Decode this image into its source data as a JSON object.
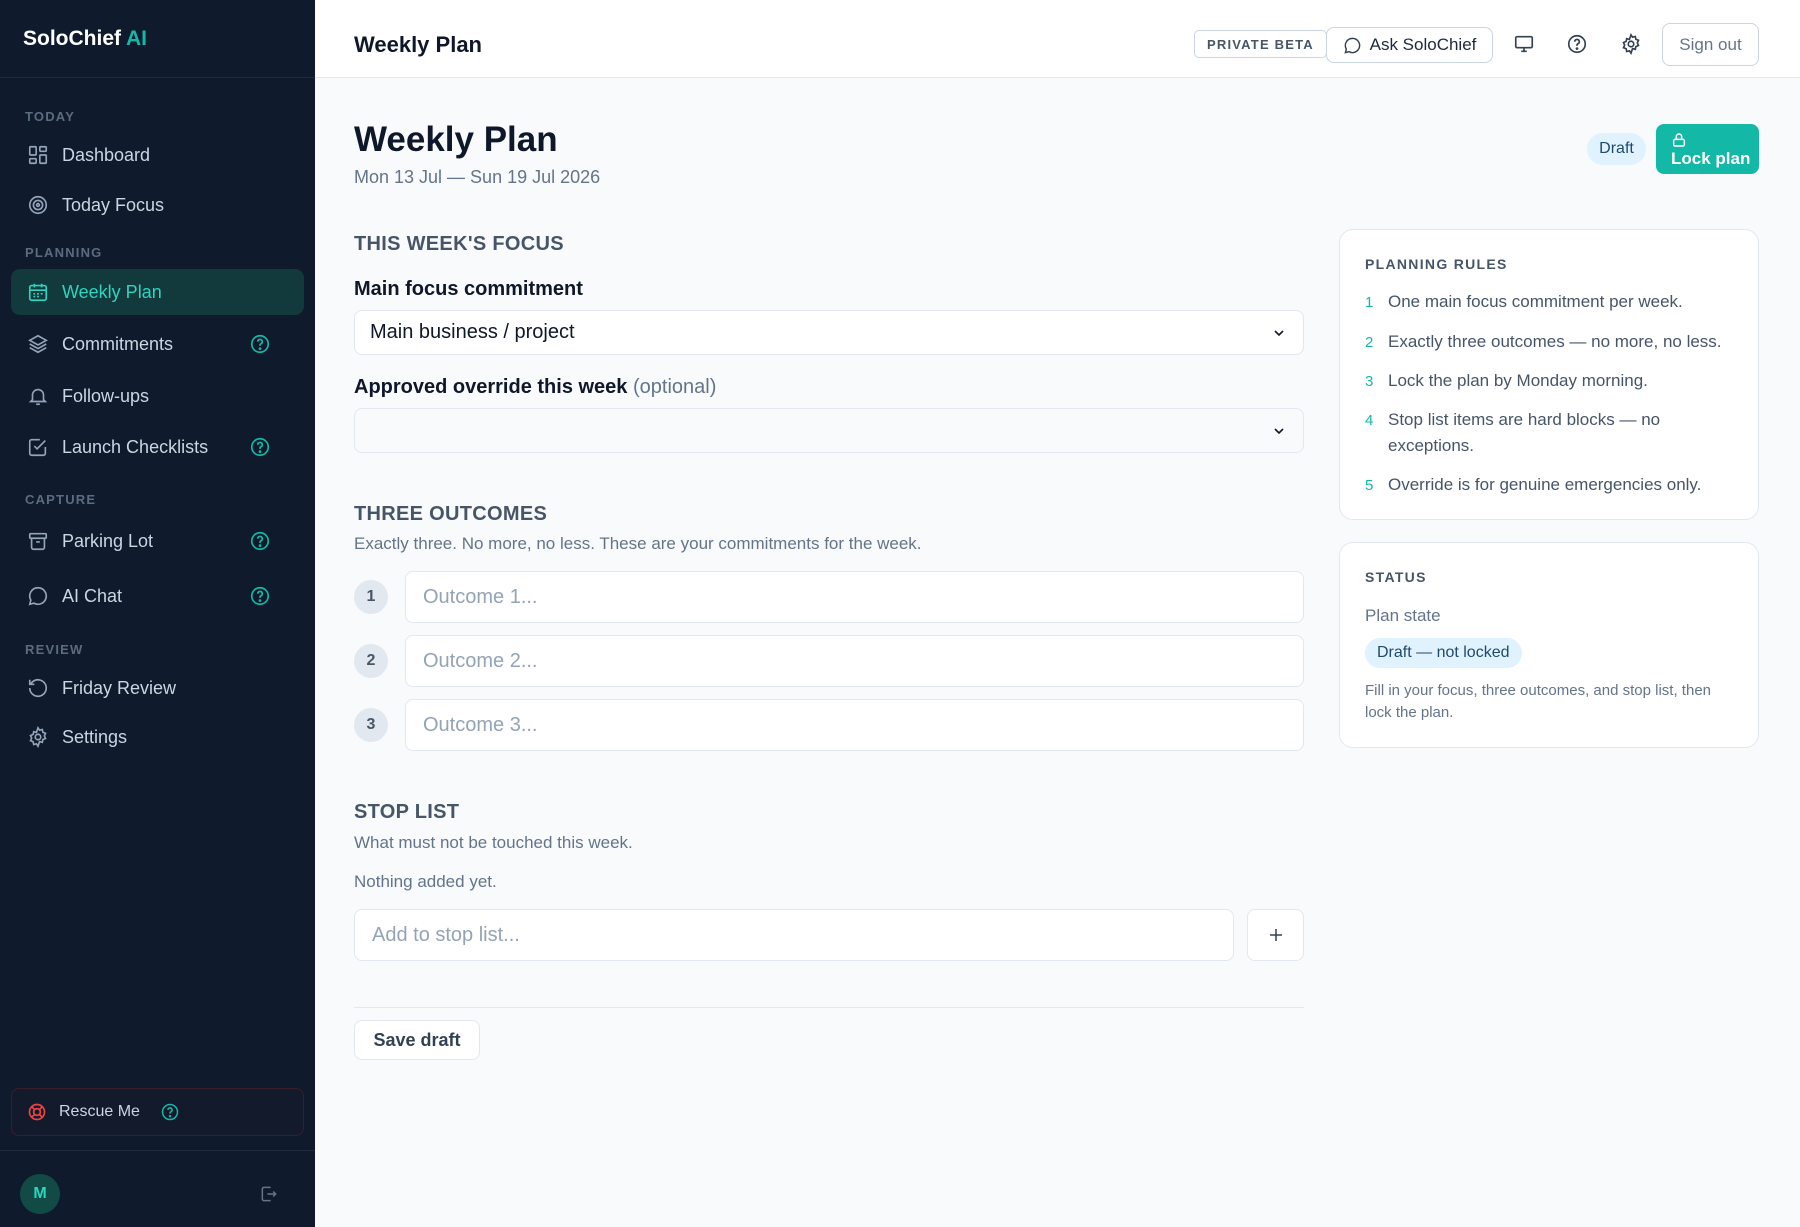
{
  "sidebar": {
    "brand": "SoloChief",
    "brand_suffix": "AI",
    "sections": {
      "today": "TODAY",
      "planning": "PLANNING",
      "capture": "CAPTURE",
      "review": "REVIEW"
    },
    "items": [
      {
        "label": "Dashboard",
        "icon": "dashboard-icon"
      },
      {
        "label": "Today Focus",
        "icon": "target-icon"
      },
      {
        "label": "Weekly Plan",
        "icon": "calendar-icon",
        "active": true
      },
      {
        "label": "Commitments",
        "icon": "layers-icon",
        "help": true
      },
      {
        "label": "Follow-ups",
        "icon": "bell-icon"
      },
      {
        "label": "Launch Checklists",
        "icon": "checkbox-icon",
        "help": true
      },
      {
        "label": "Parking Lot",
        "icon": "archive-icon",
        "help": true
      },
      {
        "label": "AI Chat",
        "icon": "chat-icon",
        "help": true
      },
      {
        "label": "Friday Review",
        "icon": "refresh-icon"
      },
      {
        "label": "Settings",
        "icon": "gear-icon"
      }
    ],
    "rescue_label": "Rescue Me",
    "avatar_initial": "M"
  },
  "topbar": {
    "title": "Weekly Plan",
    "beta_badge": "PRIVATE BETA",
    "ask_label": "Ask SoloChief",
    "signout_label": "Sign out"
  },
  "header": {
    "title": "Weekly Plan",
    "date_range": "Mon 13 Jul — Sun 19 Jul 2026",
    "status_badge": "Draft",
    "lock_label": "Lock plan"
  },
  "focus": {
    "section_title": "THIS WEEK'S FOCUS",
    "main_label": "Main focus commitment",
    "main_value": "Main business / project",
    "override_label": "Approved override this week",
    "override_optional": "(optional)",
    "override_value": ""
  },
  "outcomes": {
    "section_title": "THREE OUTCOMES",
    "subtitle": "Exactly three. No more, no less. These are your commitments for the week.",
    "items": [
      {
        "num": "1",
        "placeholder": "Outcome 1...",
        "value": ""
      },
      {
        "num": "2",
        "placeholder": "Outcome 2...",
        "value": ""
      },
      {
        "num": "3",
        "placeholder": "Outcome 3...",
        "value": ""
      }
    ]
  },
  "stop_list": {
    "section_title": "STOP LIST",
    "subtitle": "What must not be touched this week.",
    "empty_text": "Nothing added yet.",
    "placeholder": "Add to stop list...",
    "save_label": "Save draft"
  },
  "rules": {
    "title": "PLANNING RULES",
    "items": [
      {
        "num": "1",
        "text": "One main focus commitment per week."
      },
      {
        "num": "2",
        "text": "Exactly three outcomes — no more, no less."
      },
      {
        "num": "3",
        "text": "Lock the plan by Monday morning."
      },
      {
        "num": "4",
        "text": "Stop list items are hard blocks — no exceptions."
      },
      {
        "num": "5",
        "text": "Override is for genuine emergencies only."
      }
    ]
  },
  "status": {
    "title": "STATUS",
    "plan_state_label": "Plan state",
    "plan_state_value": "Draft — not locked",
    "note": "Fill in your focus, three outcomes, and stop list, then lock the plan."
  },
  "colors": {
    "accent": "#14b8a6",
    "sidebar_bg": "#0f1b2d",
    "danger": "#ef4444"
  }
}
